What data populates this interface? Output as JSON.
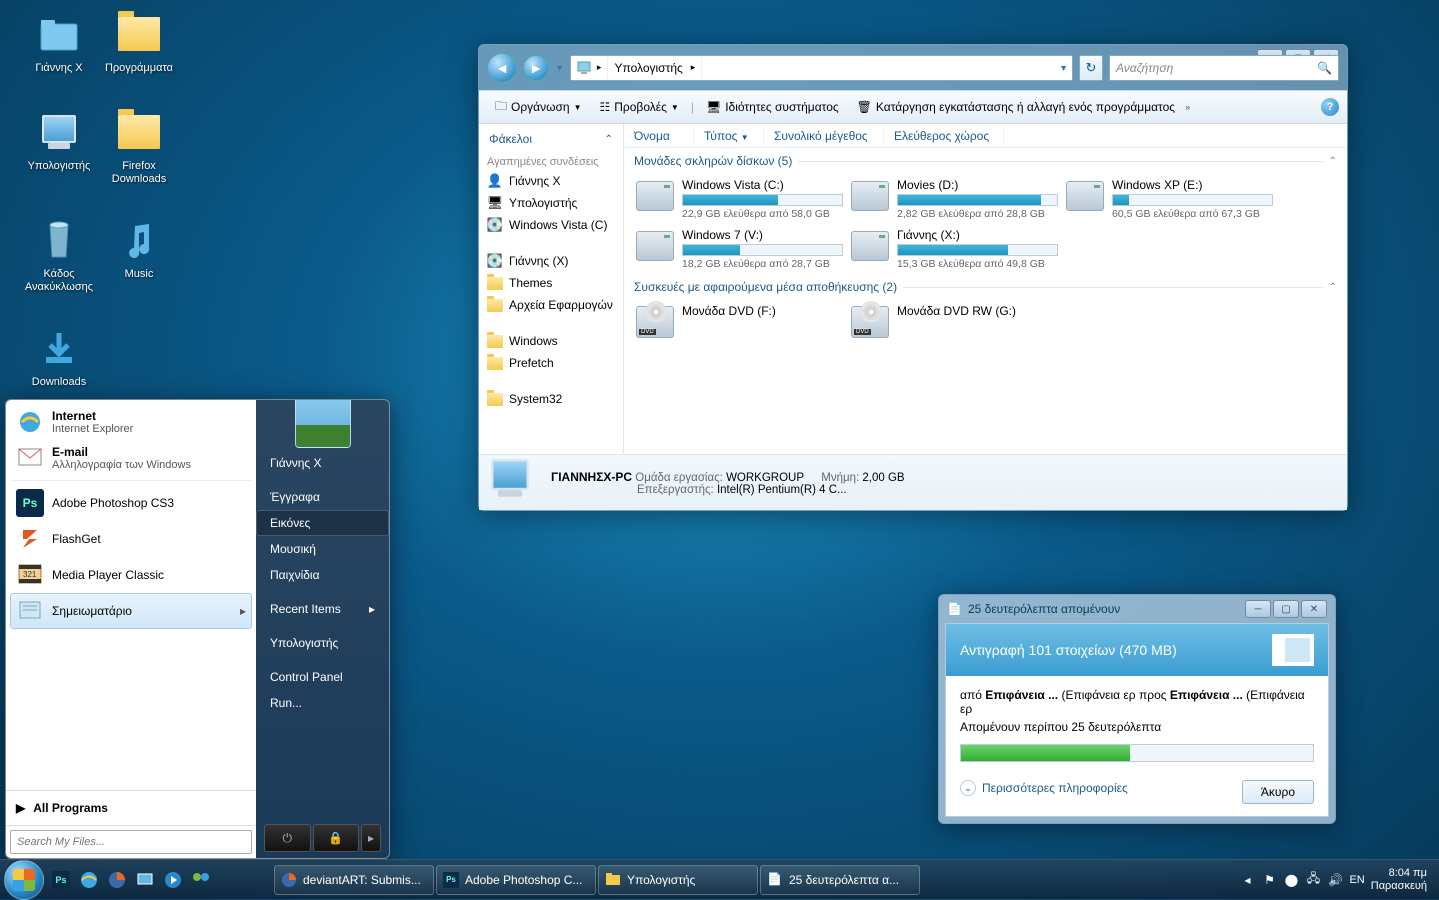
{
  "desktop": {
    "icons": [
      {
        "label": "Γιάννης Χ",
        "icon": "user-folder"
      },
      {
        "label": "Προγράμματα",
        "icon": "folder"
      },
      {
        "label": "Υπολογιστής",
        "icon": "computer"
      },
      {
        "label": "Firefox Downloads",
        "icon": "folder"
      },
      {
        "label": "Κάδος Ανακύκλωσης",
        "icon": "recycle-bin"
      },
      {
        "label": "Music",
        "icon": "music"
      },
      {
        "label": "Downloads",
        "icon": "downloads"
      }
    ]
  },
  "start_menu": {
    "internet": {
      "title": "Internet",
      "sub": "Internet Explorer"
    },
    "email": {
      "title": "E-mail",
      "sub": "Αλληλογραφία των Windows"
    },
    "programs": [
      "Adobe Photoshop CS3",
      "FlashGet",
      "Media Player Classic",
      "Σημειωματάριο"
    ],
    "all_programs": "All Programs",
    "search_placeholder": "Search My Files...",
    "right": [
      "Γιάννης Χ",
      "Έγγραφα",
      "Εικόνες",
      "Μουσική",
      "Παιχνίδια",
      "Recent Items",
      "Υπολογιστής",
      "Control Panel",
      "Run..."
    ],
    "right_selected_index": 2
  },
  "explorer": {
    "breadcrumb": [
      "",
      "Υπολογιστής",
      ""
    ],
    "search_placeholder": "Αναζήτηση",
    "toolbar": {
      "organize": "Οργάνωση",
      "views": "Προβολές",
      "sysprops": "Ιδιότητες συστήματος",
      "uninstall": "Κατάργηση εγκατάστασης ή αλλαγή ενός προγράμματος"
    },
    "nav": {
      "folders_header": "Φάκελοι",
      "fav_header": "Αγαπημένες συνδέσεις",
      "favorites": [
        "Γιάννης Χ",
        "Υπολογιστής",
        "Windows Vista (C)"
      ],
      "tree": [
        "Γιάννης (X)",
        "Themes",
        "Αρχεία Εφαρμογών",
        "Windows",
        "Prefetch",
        "System32"
      ]
    },
    "columns": [
      "Όνομα",
      "Τύπος",
      "Συνολικό μέγεθος",
      "Ελεύθερος χώρος"
    ],
    "section_hdd": "Μονάδες σκληρών δίσκων (5)",
    "drives": [
      {
        "name": "Windows Vista (C:)",
        "free": "22,9 GB ελεύθερα από 58,0 GB",
        "pct": 60
      },
      {
        "name": "Movies (D:)",
        "free": "2,82 GB ελεύθερα από 28,8 GB",
        "pct": 90
      },
      {
        "name": "Windows XP (E:)",
        "free": "60,5 GB ελεύθερα από 67,3 GB",
        "pct": 10
      },
      {
        "name": "Windows 7 (V:)",
        "free": "18,2 GB ελεύθερα από 28,7 GB",
        "pct": 36
      },
      {
        "name": "Γιάννης (X:)",
        "free": "15,3 GB ελεύθερα από 49,8 GB",
        "pct": 69
      }
    ],
    "section_removable": "Συσκευές με αφαιρούμενα μέσα αποθήκευσης (2)",
    "removable": [
      {
        "name": "Μονάδα DVD (F:)"
      },
      {
        "name": "Μονάδα DVD RW (G:)"
      }
    ],
    "details": {
      "pc_name": "ΓΙΑΝΝΗΣΧ-PC",
      "workgroup_label": "Ομάδα εργασίας:",
      "workgroup": "WORKGROUP",
      "cpu_label": "Επεξεργαστής:",
      "cpu": "Intel(R) Pentium(R) 4 C...",
      "mem_label": "Μνήμη:",
      "mem": "2,00 GB"
    }
  },
  "copy": {
    "title": "25 δευτερόλεπτα απομένουν",
    "heading": "Αντιγραφή 101 στοιχείων (470 MB)",
    "line_from": "από",
    "line_to": "προς",
    "surface": "Επιφάνεια ...",
    "surface_paren": "(Επιφάνεια ερ",
    "remaining": "Απομένουν περίπου 25 δευτερόλεπτα",
    "progress_pct": 48,
    "more": "Περισσότερες πληροφορίες",
    "cancel": "Άκυρο"
  },
  "taskbar": {
    "tasks": [
      {
        "label": "deviantART: Submis...",
        "icon": "firefox"
      },
      {
        "label": "Adobe Photoshop C...",
        "icon": "ps"
      },
      {
        "label": "Υπολογιστής",
        "icon": "explorer"
      },
      {
        "label": "25 δευτερόλεπτα α...",
        "icon": "copy"
      }
    ],
    "lang": "EN",
    "time": "8:04 πμ",
    "day": "Παρασκευή"
  }
}
